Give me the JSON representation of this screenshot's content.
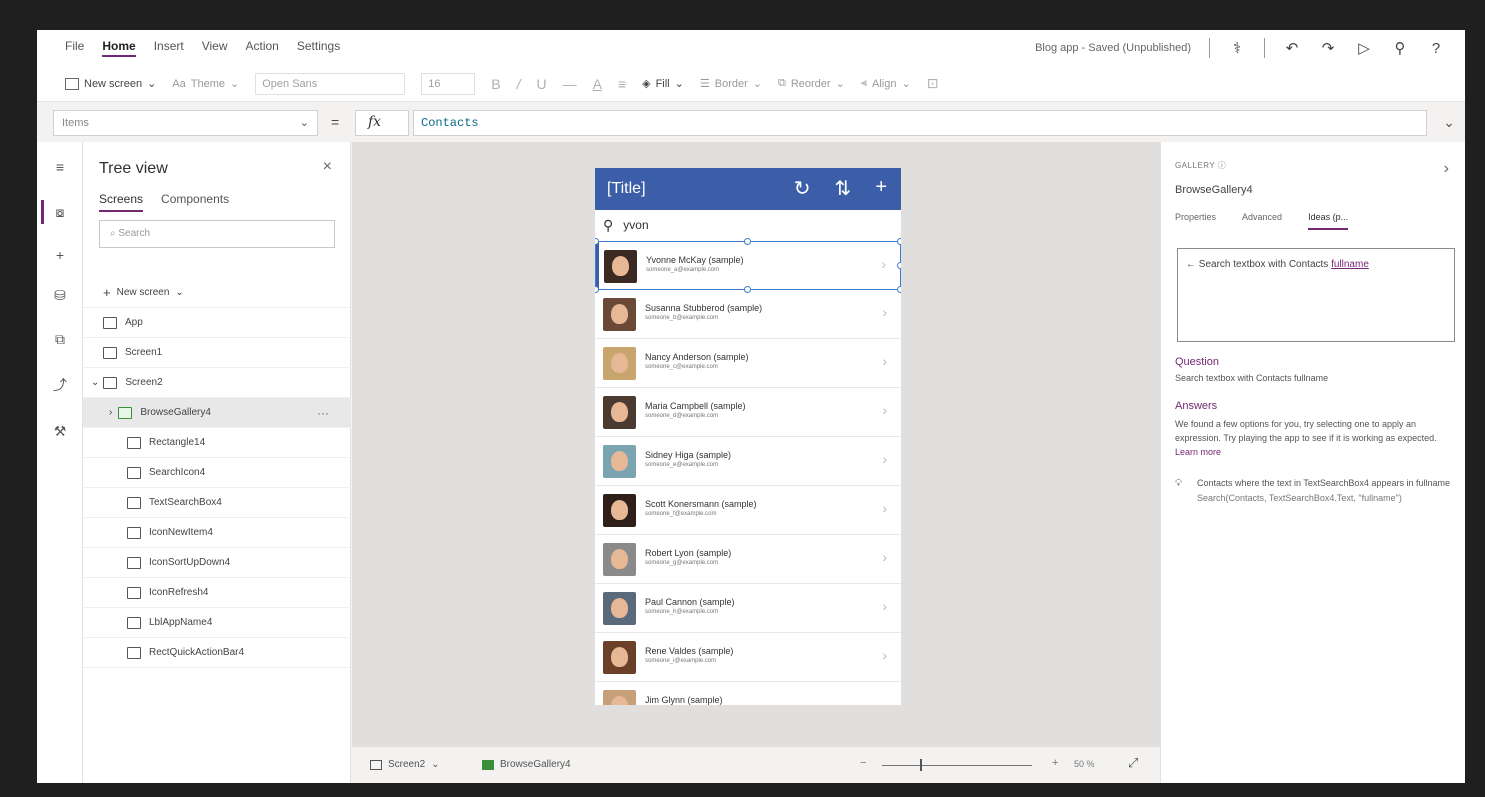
{
  "menubar": {
    "items": [
      "File",
      "Home",
      "Insert",
      "View",
      "Action",
      "Settings"
    ],
    "active": "Home",
    "status": "Blog app - Saved (Unpublished)"
  },
  "toolbar": {
    "new_screen": "New screen",
    "theme": "Theme",
    "font": "Open Sans",
    "font_size": "16",
    "fill": "Fill",
    "border": "Border",
    "reorder": "Reorder",
    "align": "Align"
  },
  "formula": {
    "property": "Items",
    "eq": "=",
    "fx": "fx",
    "value": "Contacts"
  },
  "tree": {
    "title": "Tree view",
    "tabs": [
      "Screens",
      "Components"
    ],
    "search_placeholder": "Search",
    "new_screen": "New screen",
    "items": [
      {
        "label": "App",
        "level": 0
      },
      {
        "label": "Screen1",
        "level": 0
      },
      {
        "label": "Screen2",
        "level": 0
      },
      {
        "label": "BrowseGallery4",
        "level": 1
      },
      {
        "label": "Rectangle14",
        "level": 2
      },
      {
        "label": "SearchIcon4",
        "level": 2
      },
      {
        "label": "TextSearchBox4",
        "level": 2
      },
      {
        "label": "IconNewItem4",
        "level": 2
      },
      {
        "label": "IconSortUpDown4",
        "level": 2
      },
      {
        "label": "IconRefresh4",
        "level": 2
      },
      {
        "label": "LblAppName4",
        "level": 2
      },
      {
        "label": "RectQuickActionBar4",
        "level": 2
      }
    ],
    "more": "···"
  },
  "phone": {
    "title": "[Title]",
    "search_value": "yvon",
    "contacts": [
      {
        "name": "Yvonne McKay (sample)",
        "email": "someone_a@example.com"
      },
      {
        "name": "Susanna Stubberod (sample)",
        "email": "someone_b@example.com"
      },
      {
        "name": "Nancy Anderson (sample)",
        "email": "someone_c@example.com"
      },
      {
        "name": "Maria Campbell (sample)",
        "email": "someone_d@example.com"
      },
      {
        "name": "Sidney Higa (sample)",
        "email": "someone_e@example.com"
      },
      {
        "name": "Scott Konersmann (sample)",
        "email": "someone_f@example.com"
      },
      {
        "name": "Robert Lyon (sample)",
        "email": "someone_g@example.com"
      },
      {
        "name": "Paul Cannon (sample)",
        "email": "someone_h@example.com"
      },
      {
        "name": "Rene Valdes (sample)",
        "email": "someone_i@example.com"
      },
      {
        "name": "Jim Glynn (sample)",
        "email": ""
      }
    ]
  },
  "statusbar": {
    "screen": "Screen2",
    "control": "BrowseGallery4",
    "zoom": "50 %"
  },
  "panel": {
    "kind": "GALLERY",
    "control": "BrowseGallery4",
    "tabs": [
      "Properties",
      "Advanced",
      "Ideas (p..."
    ],
    "idea_prefix": "Search textbox with Contacts",
    "idea_link": "fullname",
    "question_head": "Question",
    "question": "Search textbox with Contacts fullname",
    "answers_head": "Answers",
    "answers": "We found a few options for you, try selecting one to apply an expression. Try playing the app to see if it is working as expected.",
    "learn_more": "Learn more",
    "suggestion_title": "Contacts where the text in TextSearchBox4 appears in fullname",
    "suggestion_formula": "Search(Contacts, TextSearchBox4.Text, \"fullname\")"
  },
  "colors": {
    "accent": "#742774",
    "header": "#3c5ea8",
    "selection": "#3c7fd1"
  }
}
